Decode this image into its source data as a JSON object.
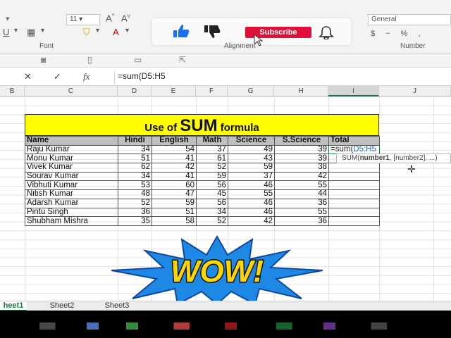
{
  "ribbon": {
    "font_size": "11",
    "font_group_label": "Font",
    "alignment_group_label": "Alignment",
    "number_group_label": "Number",
    "number_format": "General",
    "number_format_symbols": "$ ~ % ,",
    "subscribe_label": "Subscribe"
  },
  "formula_bar": {
    "cancel": "✕",
    "enter": "✓",
    "fx": "fx",
    "formula": "=sum(D5:H5"
  },
  "columns": [
    "B",
    "C",
    "D",
    "E",
    "F",
    "G",
    "H",
    "I",
    "J"
  ],
  "sheet": {
    "title_prefix": "Use of",
    "title_main": "SUM",
    "title_suffix": "formula",
    "headers": [
      "Name",
      "Hindi",
      "English",
      "Math",
      "Science",
      "S.Science",
      "Total"
    ],
    "rows": [
      {
        "name": "Raju Kumar",
        "hindi": "34",
        "english": "54",
        "math": "37",
        "science": "49",
        "sscience": "39"
      },
      {
        "name": "Monu Kumar",
        "hindi": "51",
        "english": "41",
        "math": "61",
        "science": "43",
        "sscience": "39"
      },
      {
        "name": "Vivek Kumar",
        "hindi": "62",
        "english": "42",
        "math": "52",
        "science": "59",
        "sscience": "38"
      },
      {
        "name": "Sourav Kumar",
        "hindi": "34",
        "english": "41",
        "math": "59",
        "science": "37",
        "sscience": "42"
      },
      {
        "name": "Vibhuti Kumar",
        "hindi": "53",
        "english": "60",
        "math": "56",
        "science": "46",
        "sscience": "55"
      },
      {
        "name": "Nitish Kumar",
        "hindi": "48",
        "english": "47",
        "math": "45",
        "science": "55",
        "sscience": "44"
      },
      {
        "name": "Adarsh Kumar",
        "hindi": "52",
        "english": "59",
        "math": "56",
        "science": "46",
        "sscience": "36"
      },
      {
        "name": "Pintu Singh",
        "hindi": "36",
        "english": "51",
        "math": "34",
        "science": "46",
        "sscience": "55"
      },
      {
        "name": "Shubham Mishra",
        "hindi": "35",
        "english": "58",
        "math": "52",
        "science": "42",
        "sscience": "36"
      }
    ],
    "editing_cell_prefix": "=sum(",
    "editing_cell_ref": "D5:H5"
  },
  "tooltip": {
    "func": "SUM(",
    "arg1": "number1",
    "rest": ", [number2], ...)"
  },
  "overlay_text": "WOW!",
  "tabs": [
    "heet1",
    "Sheet2",
    "Sheet3"
  ],
  "colors": {
    "title_fill": "#ffff00",
    "header_fill": "#bfbfbf",
    "excel_green": "#217346",
    "ref_blue": "#2d6db4",
    "subscribe_red": "#e0103a"
  }
}
